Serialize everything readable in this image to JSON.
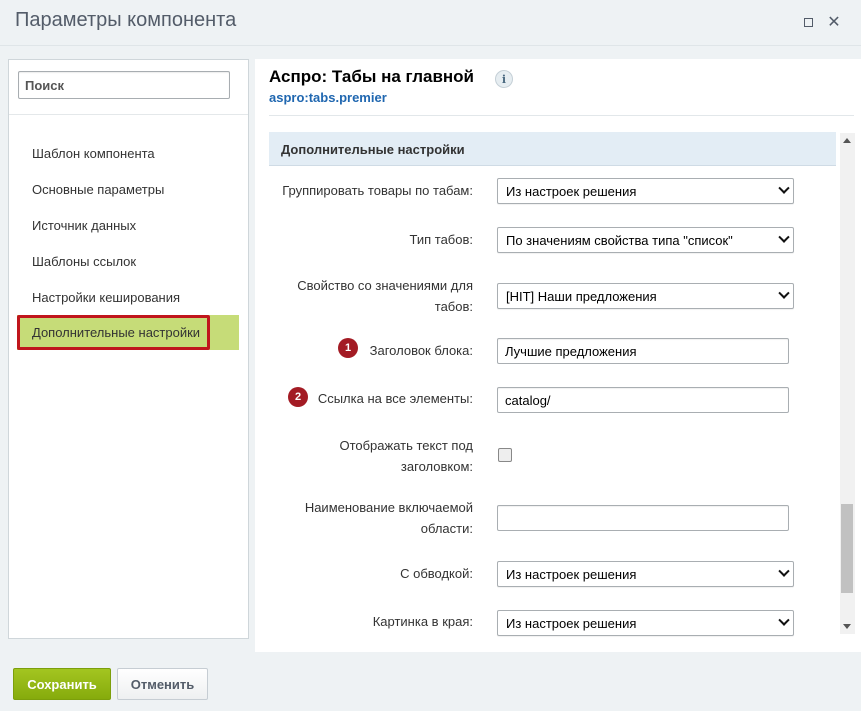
{
  "window": {
    "title": "Параметры компонента",
    "maximize_icon": "maximize-icon",
    "close_icon": "close-icon",
    "close_glyph": "✕"
  },
  "sidebar": {
    "search_placeholder": "Поиск",
    "items": [
      {
        "label": "Шаблон компонента"
      },
      {
        "label": "Основные параметры"
      },
      {
        "label": "Источник данных"
      },
      {
        "label": "Шаблоны ссылок"
      },
      {
        "label": "Настройки кеширования"
      },
      {
        "label": "Дополнительные настройки",
        "active": true
      }
    ]
  },
  "main": {
    "component_title": "Аспро: Табы на главной",
    "info_glyph": "i",
    "component_code": "aspro:tabs.premier",
    "section_title": "Дополнительные настройки",
    "fields": [
      {
        "label": "Группировать товары по табам:",
        "type": "select",
        "value": "Из настроек решения"
      },
      {
        "label": "Тип табов:",
        "type": "select",
        "value": "По значениям свойства типа \"список\""
      },
      {
        "label_line1": "Свойство со значениями для",
        "label_line2": "табов:",
        "type": "select",
        "value": "[HIT] Наши предложения"
      },
      {
        "label": "Заголовок блока:",
        "type": "text",
        "value": "Лучшие предложения",
        "badge": "1"
      },
      {
        "label": "Ссылка на все элементы:",
        "type": "text",
        "value": "catalog/",
        "badge": "2"
      },
      {
        "label_line1": "Отображать текст под",
        "label_line2": "заголовком:",
        "type": "checkbox",
        "checked": false
      },
      {
        "label_line1": "Наименование включаемой",
        "label_line2": "области:",
        "type": "text",
        "value": ""
      },
      {
        "label": "С обводкой:",
        "type": "select",
        "value": "Из настроек решения"
      },
      {
        "label": "Картинка в края:",
        "type": "select",
        "value": "Из настроек решения"
      }
    ]
  },
  "footer": {
    "save_label": "Сохранить",
    "cancel_label": "Отменить"
  },
  "colors": {
    "active_nav_bg": "#c6dc78",
    "highlight_border": "#c0161c",
    "badge_bg": "#a31b24",
    "save_button": "#95b817",
    "section_bg": "#e3edf5",
    "code_link": "#2067b0"
  }
}
